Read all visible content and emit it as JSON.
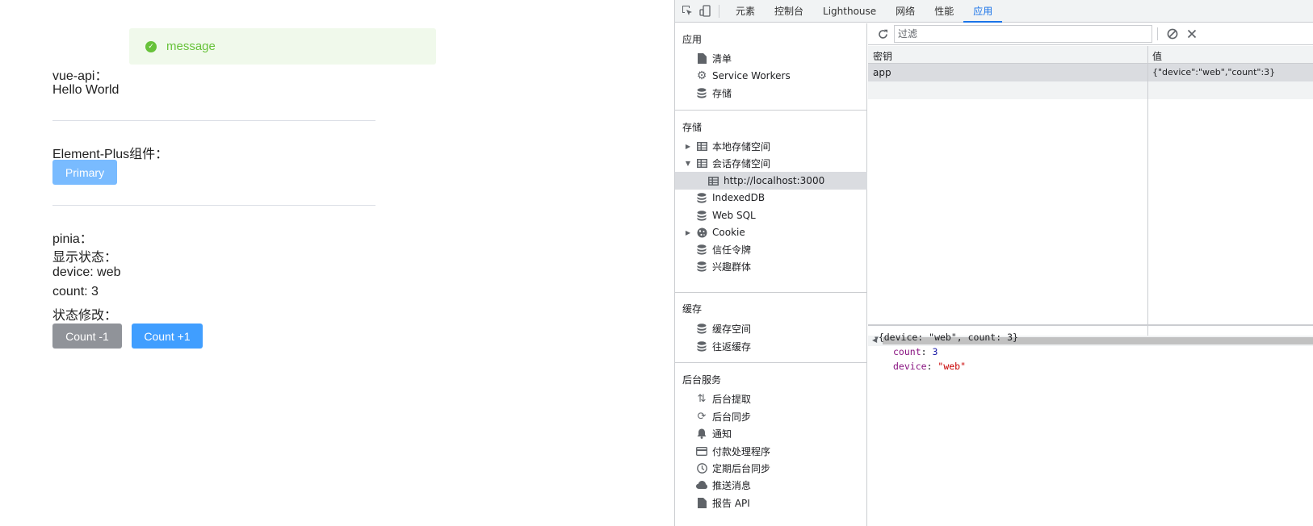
{
  "app": {
    "toast": "message",
    "vueapi_label": "vue-api：",
    "vueapi_value": "Hello World",
    "element_label": "Element-Plus组件：",
    "primary_button": "Primary",
    "pinia_label": "pinia：",
    "show_state_label": "显示状态：",
    "device_line": "device: web",
    "count_line": "count: 3",
    "modify_label": "状态修改：",
    "dec_button": "Count -1",
    "inc_button": "Count +1"
  },
  "colors": {
    "success": "#67c23a",
    "success_bg": "#f0f9eb",
    "primary_light": "#79bbff",
    "primary": "#409eff",
    "info": "#909399",
    "devtools_accent": "#1a73e8"
  },
  "devtools": {
    "tabs": [
      "元素",
      "控制台",
      "Lighthouse",
      "网络",
      "性能",
      "应用"
    ],
    "active_tab": "应用",
    "sidebar": {
      "application": {
        "title": "应用",
        "items": [
          {
            "label": "清单",
            "icon": "file-icon"
          },
          {
            "label": "Service Workers",
            "icon": "gear-icon"
          },
          {
            "label": "存储",
            "icon": "database-icon"
          }
        ]
      },
      "storage": {
        "title": "存储",
        "items": [
          {
            "label": "本地存储空间",
            "icon": "grid-icon",
            "expander": "▶"
          },
          {
            "label": "会话存储空间",
            "icon": "grid-icon",
            "expander": "▼"
          },
          {
            "label": "http://localhost:3000",
            "icon": "grid-icon",
            "selected": true
          },
          {
            "label": "IndexedDB",
            "icon": "database-icon"
          },
          {
            "label": "Web SQL",
            "icon": "database-icon"
          },
          {
            "label": "Cookie",
            "icon": "cookie-icon",
            "expander": "▶"
          },
          {
            "label": "信任令牌",
            "icon": "database-icon"
          },
          {
            "label": "兴趣群体",
            "icon": "database-icon"
          }
        ]
      },
      "cache": {
        "title": "缓存",
        "items": [
          {
            "label": "缓存空间",
            "icon": "database-icon"
          },
          {
            "label": "往返缓存",
            "icon": "database-icon"
          }
        ]
      },
      "background": {
        "title": "后台服务",
        "items": [
          {
            "label": "后台提取",
            "icon": "arrows-updown-icon"
          },
          {
            "label": "后台同步",
            "icon": "sync-icon"
          },
          {
            "label": "通知",
            "icon": "bell-icon"
          },
          {
            "label": "付款处理程序",
            "icon": "card-icon"
          },
          {
            "label": "定期后台同步",
            "icon": "clock-icon"
          },
          {
            "label": "推送消息",
            "icon": "cloud-icon"
          },
          {
            "label": "报告 API",
            "icon": "file-icon"
          }
        ]
      }
    },
    "filter_placeholder": "过滤",
    "table": {
      "key_header": "密钥",
      "value_header": "值",
      "rows": [
        {
          "key": "app",
          "value": "{\"device\":\"web\",\"count\":3}"
        }
      ]
    },
    "preview": {
      "summary": "{device: \"web\", count: 3}",
      "count_key": "count",
      "count_value": "3",
      "device_key": "device",
      "device_value": "\"web\""
    }
  }
}
